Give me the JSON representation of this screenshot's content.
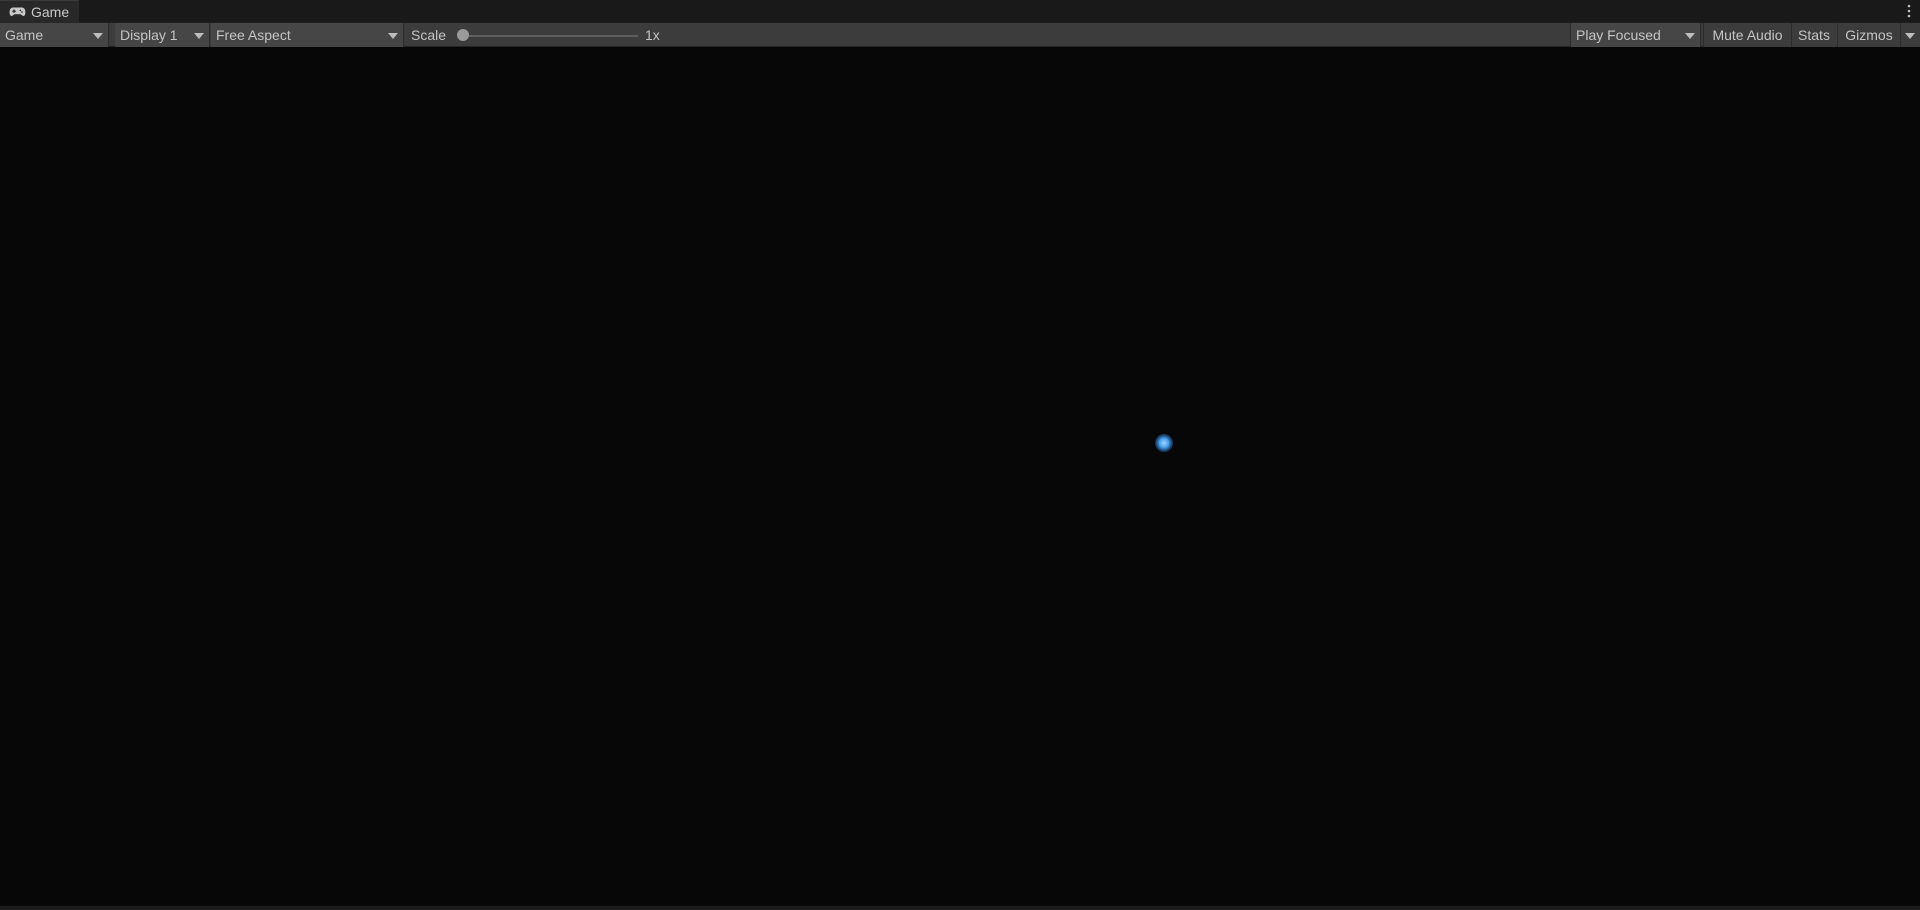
{
  "window": {
    "tab_title": "Game",
    "tab_icon": "gamepad-icon",
    "menu_icon": "kebab-menu-icon"
  },
  "toolbar": {
    "view_mode": "Game",
    "display": "Display 1",
    "aspect": "Free Aspect",
    "scale_label": "Scale",
    "scale_value": "1x",
    "play_mode": "Play Focused",
    "mute_audio": "Mute Audio",
    "stats": "Stats",
    "gizmos": "Gizmos"
  },
  "viewport": {
    "background": "#070707",
    "orb_color": "#4aa2ef"
  }
}
